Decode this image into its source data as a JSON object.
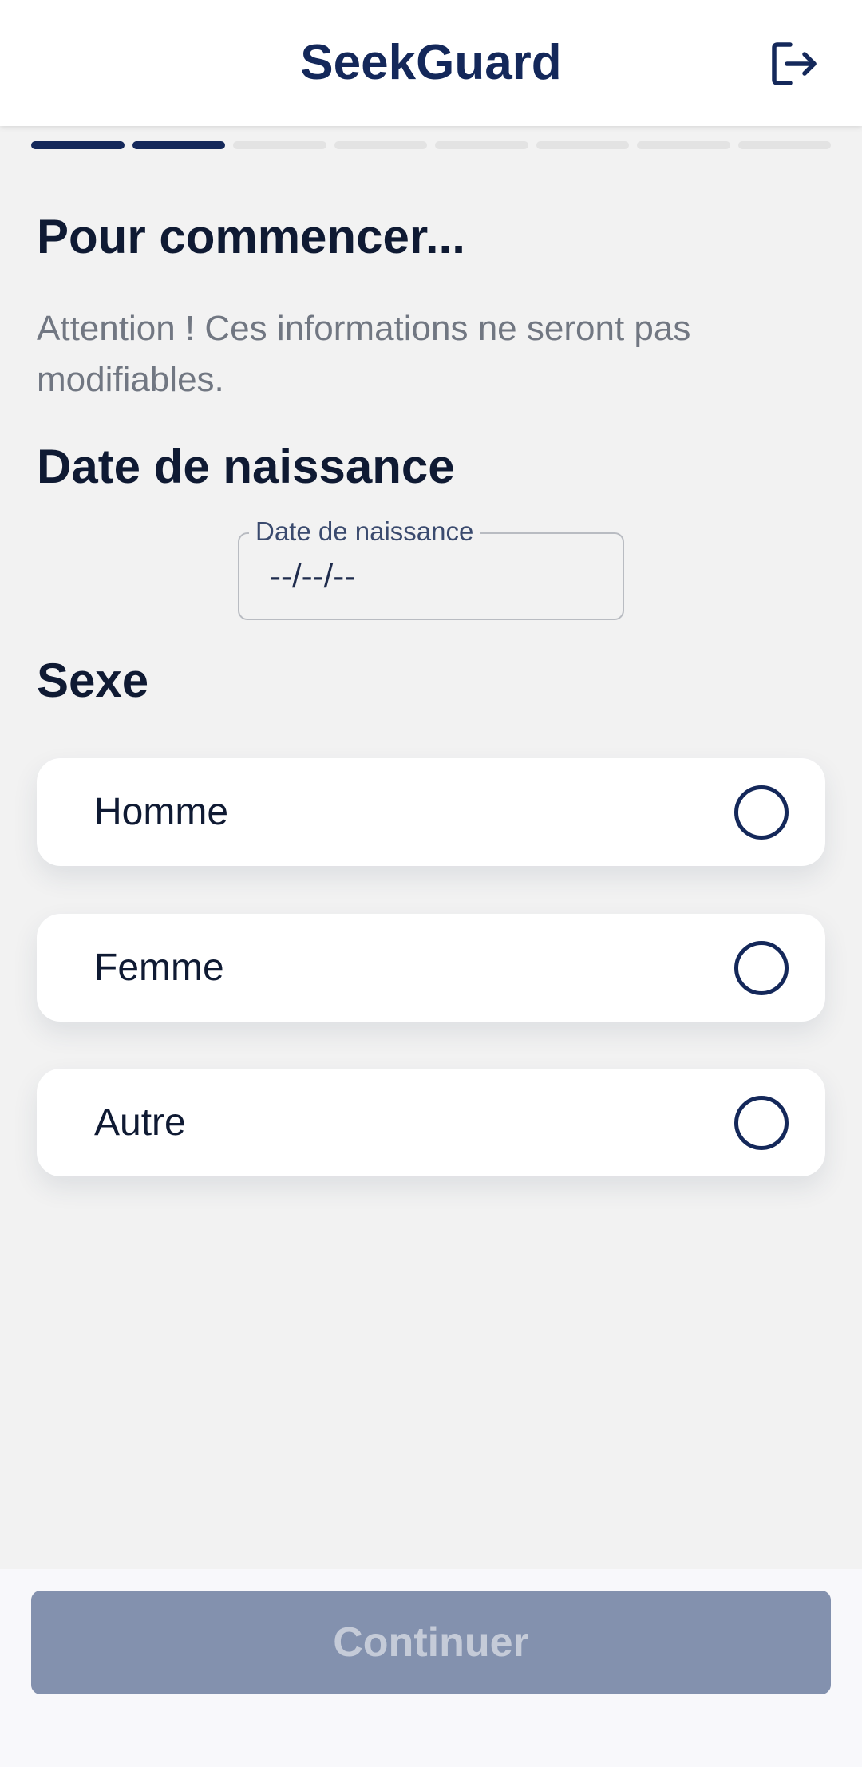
{
  "header": {
    "title": "SeekGuard",
    "logout_icon": "logout-icon"
  },
  "progress": {
    "total_steps": 8,
    "completed_steps": 2,
    "active_color": "#14285a",
    "inactive_color": "#e3e3e3"
  },
  "main": {
    "title": "Pour commencer...",
    "warning": "Attention ! Ces informations ne seront pas modifiables.",
    "dob": {
      "section_title": "Date de naissance",
      "field_label": "Date de naissance",
      "value": "--/--/--"
    },
    "sex": {
      "section_title": "Sexe",
      "options": [
        {
          "label": "Homme",
          "selected": false
        },
        {
          "label": "Femme",
          "selected": false
        },
        {
          "label": "Autre",
          "selected": false
        }
      ]
    }
  },
  "footer": {
    "continue_label": "Continuer",
    "disabled": true
  },
  "colors": {
    "brand": "#14285a",
    "button_disabled": "#8391ae",
    "background": "#f2f2f2"
  }
}
